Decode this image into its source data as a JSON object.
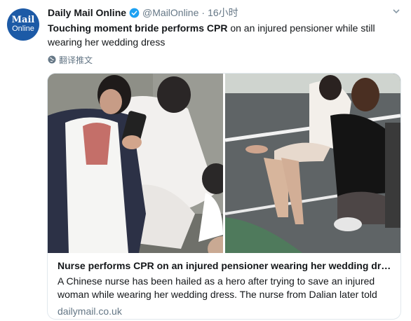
{
  "tweet": {
    "author_name": "Daily Mail Online",
    "handle": "@MailOnline",
    "separator": "·",
    "time": "16小时",
    "text_bold": "Touching moment bride performs CPR",
    "text_rest": " on an injured pensioner while still wearing her wedding dress",
    "translate_label": "翻译推文",
    "avatar_line1": "Mail",
    "avatar_line2": "Online"
  },
  "card": {
    "title": "Nurse performs CPR on an injured pensioner wearing her wedding dress",
    "description": "A Chinese nurse has been hailed as a hero after trying to save an injured woman while wearing her wedding dress. The nurse from Dalian later told",
    "domain": "dailymail.co.uk"
  },
  "colors": {
    "link_blue": "#1da1f2",
    "muted_text": "#657786",
    "avatar_bg": "#1c5aa6"
  },
  "icons": [
    "verified-badge-icon",
    "chevron-down-icon",
    "globe-icon"
  ]
}
